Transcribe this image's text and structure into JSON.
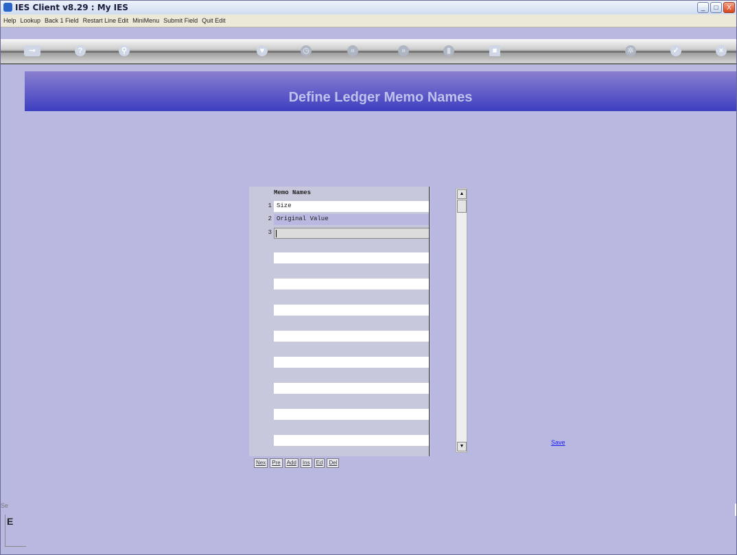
{
  "window": {
    "title": "IES Client v8.29 : My IES"
  },
  "menubar": {
    "items": [
      "Help",
      "Lookup",
      "Back 1 Field",
      "Restart Line Edit",
      "MiniMenu",
      "Submit Field",
      "Quit Edit"
    ]
  },
  "toolbar": {
    "icons": [
      "key-icon",
      "help-icon",
      "search-icon",
      "heart-icon",
      "clock-icon",
      "rewind-icon",
      "forward-icon",
      "save-icon",
      "stop-icon",
      "settings-icon",
      "check-icon",
      "close-icon"
    ]
  },
  "page": {
    "title": "Define Ledger Memo Names"
  },
  "grid": {
    "header": "Memo Names",
    "rows": [
      {
        "num": "1",
        "value": "Size"
      },
      {
        "num": "2",
        "value": "Original Value"
      },
      {
        "num": "3",
        "value": ""
      }
    ]
  },
  "nav": {
    "buttons": [
      "Nex",
      "Pre",
      "Add",
      "Ins",
      "Ed",
      "Del"
    ]
  },
  "actions": {
    "save_label": "Save"
  },
  "left_panel": {
    "stub_text": "Se",
    "box_text": "E"
  },
  "colors": {
    "header_gradient_top": "#8a7fd0",
    "header_gradient_bottom": "#3d3fc0",
    "background": "#b8b8e0",
    "link": "#1a1aff"
  }
}
